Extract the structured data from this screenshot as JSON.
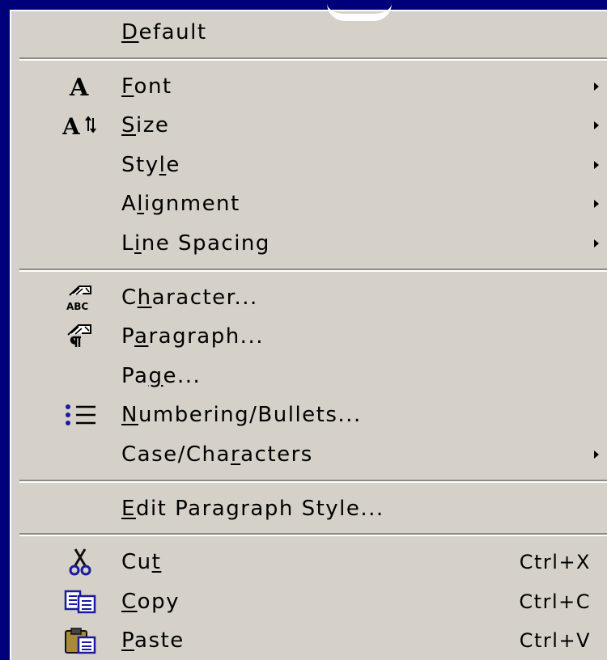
{
  "menu": {
    "groups": [
      [
        {
          "label": "Default",
          "mnemonic": 0
        }
      ],
      [
        {
          "label": "Font",
          "mnemonic": 0,
          "icon": "font-a-icon",
          "submenu": true
        },
        {
          "label": "Size",
          "mnemonic": 0,
          "icon": "font-size-icon",
          "submenu": true
        },
        {
          "label": "Style",
          "mnemonic": 3,
          "submenu": true
        },
        {
          "label": "Alignment",
          "mnemonic": 1,
          "submenu": true
        },
        {
          "label": "Line Spacing",
          "mnemonic": 1,
          "submenu": true
        }
      ],
      [
        {
          "label": "Character...",
          "mnemonic": 1,
          "icon": "character-icon"
        },
        {
          "label": "Paragraph...",
          "mnemonic": 1,
          "icon": "paragraph-icon"
        },
        {
          "label": "Page...",
          "mnemonic": 2
        },
        {
          "label": "Numbering/Bullets...",
          "mnemonic": 0,
          "icon": "bullet-list-icon"
        },
        {
          "label": "Case/Characters",
          "mnemonic": 8,
          "submenu": true
        }
      ],
      [
        {
          "label": "Edit Paragraph Style...",
          "mnemonic": 0
        }
      ],
      [
        {
          "label": "Cut",
          "mnemonic": 2,
          "icon": "scissors-icon",
          "shortcut": "Ctrl+X"
        },
        {
          "label": "Copy",
          "mnemonic": 0,
          "icon": "copy-icon",
          "shortcut": "Ctrl+C"
        },
        {
          "label": "Paste",
          "mnemonic": 0,
          "icon": "paste-icon",
          "shortcut": "Ctrl+V"
        }
      ]
    ]
  },
  "colors": {
    "background": "#00007a",
    "menu_face": "#d5d1c8"
  }
}
